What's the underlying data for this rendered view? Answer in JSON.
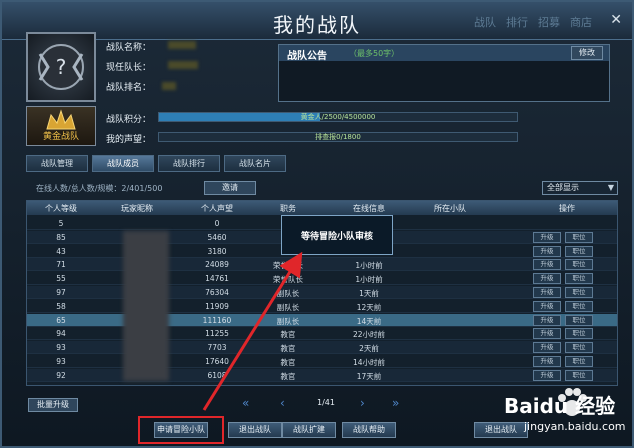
{
  "window": {
    "title": "我的战队",
    "close_glyph": "✕",
    "ghost_tabs": [
      "战队",
      "排行",
      "招募",
      "商店"
    ]
  },
  "team_info": {
    "name_label": "战队名称：",
    "leader_label": "现任队长：",
    "rank_label": "战队排名：",
    "points_label": "战队积分：",
    "reputation_label": "我的声望：",
    "rank_badge": "黄金战队",
    "points_bar_text": "黄金人/2500/4500000",
    "points_progress": 0.45,
    "reputation_bar_text": "排查报0/1800",
    "reputation_progress": 0.0
  },
  "notice": {
    "title": "战队公告",
    "limit": "（最多50字）",
    "edit_label": "修改"
  },
  "tabs": [
    "战队管理",
    "战队成员",
    "战队排行",
    "战队名片"
  ],
  "active_tab": 1,
  "members_header": {
    "online_text": "在线人数/总人数/规模：2/401/500",
    "disband_label": "邀请",
    "filter_value": "全部显示",
    "filter_arrow": "▼"
  },
  "columns": [
    "个人等级",
    "玩家昵称",
    "个人声望",
    "职务",
    "在线信息",
    "所在小队",
    "操作"
  ],
  "rows": [
    {
      "level": "5",
      "rep": "0",
      "role": "",
      "online": "",
      "actions": []
    },
    {
      "level": "85",
      "rep": "5460",
      "role": "",
      "online": "",
      "actions": [
        "升级",
        "职位"
      ]
    },
    {
      "level": "43",
      "rep": "3180",
      "role": "",
      "online": "",
      "actions": [
        "升级",
        "职位"
      ]
    },
    {
      "level": "71",
      "rep": "24089",
      "role": "荣誉队长",
      "online": "1小时前",
      "actions": [
        "升级",
        "职位"
      ]
    },
    {
      "level": "55",
      "rep": "14761",
      "role": "荣誉队长",
      "online": "1小时前",
      "actions": [
        "升级",
        "职位"
      ]
    },
    {
      "level": "97",
      "rep": "76304",
      "role": "副队长",
      "online": "1天前",
      "actions": [
        "升级",
        "职位"
      ]
    },
    {
      "level": "58",
      "rep": "11909",
      "role": "副队长",
      "online": "12天前",
      "actions": [
        "升级",
        "职位"
      ]
    },
    {
      "level": "65",
      "rep": "111160",
      "role": "副队长",
      "online": "14天前",
      "actions": [
        "升级",
        "职位"
      ]
    },
    {
      "level": "94",
      "rep": "11255",
      "role": "教官",
      "online": "22小时前",
      "actions": [
        "升级",
        "职位"
      ]
    },
    {
      "level": "93",
      "rep": "7703",
      "role": "教官",
      "online": "2天前",
      "actions": [
        "升级",
        "职位"
      ]
    },
    {
      "level": "93",
      "rep": "17640",
      "role": "教官",
      "online": "14小时前",
      "actions": [
        "升级",
        "职位"
      ]
    },
    {
      "level": "92",
      "rep": "6108",
      "role": "教官",
      "online": "17天前",
      "actions": [
        "升级",
        "职位"
      ]
    }
  ],
  "popup": {
    "text": "等待冒险小队审核"
  },
  "pager": {
    "first": "«",
    "prev": "‹",
    "page": "1/41",
    "next": "›",
    "last": "»"
  },
  "bottom": {
    "batch_label": "批量升级",
    "apply_label": "申请冒险小队",
    "quit_label": "退出战队",
    "expand_label": "战队扩建",
    "help_label": "战队帮助",
    "exit_label": "退出战队"
  },
  "watermark": {
    "brand": "Baidu 经验",
    "url": "jingyan.baidu.com"
  },
  "colors": {
    "highlight": "#e0262a",
    "points_bar": "#2e7fb6",
    "reputation_bar": "#3b9a4e"
  }
}
